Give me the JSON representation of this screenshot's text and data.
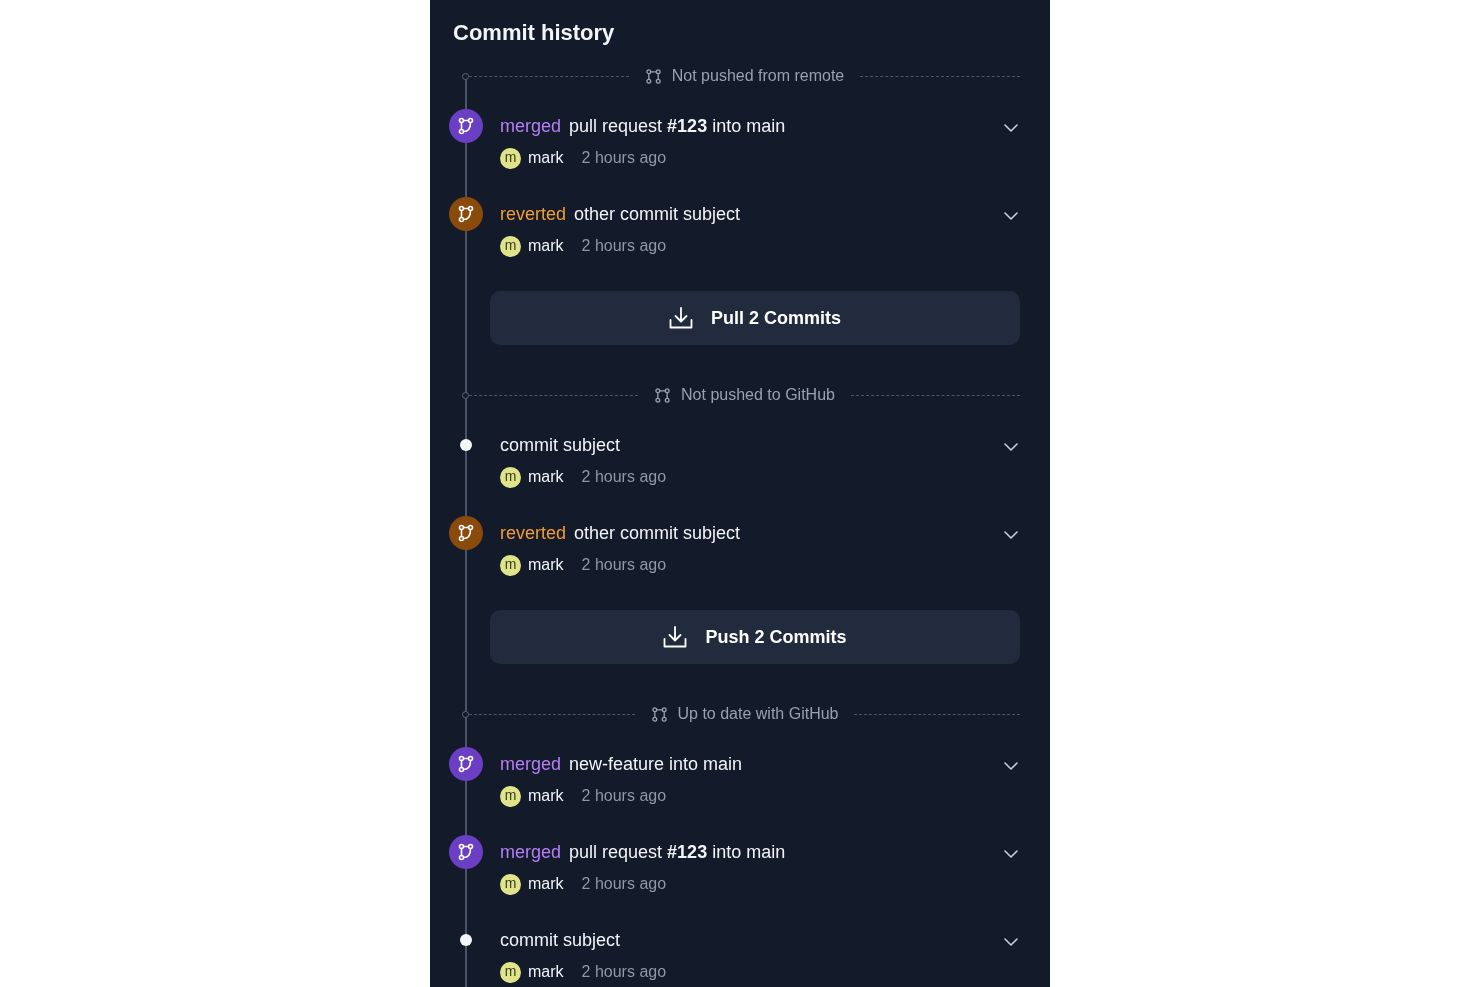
{
  "title": "Commit history",
  "sections": [
    {
      "status": "Not pushed from remote",
      "commits": [
        {
          "kind": "merge",
          "verb": "merged",
          "subject": "pull request **#123** into main",
          "avatar": "m",
          "author": "mark",
          "time": "2 hours ago"
        },
        {
          "kind": "revert",
          "verb": "reverted",
          "subject": "other commit subject",
          "avatar": "m",
          "author": "mark",
          "time": "2 hours ago"
        }
      ],
      "action": {
        "label": "Pull 2 Commits"
      }
    },
    {
      "status": "Not pushed to GitHub",
      "commits": [
        {
          "kind": "plain",
          "subject": "commit subject",
          "avatar": "m",
          "author": "mark",
          "time": "2 hours ago"
        },
        {
          "kind": "revert",
          "verb": "reverted",
          "subject": "other commit subject",
          "avatar": "m",
          "author": "mark",
          "time": "2 hours ago"
        }
      ],
      "action": {
        "label": "Push 2 Commits"
      }
    },
    {
      "status": "Up to date with GitHub",
      "commits": [
        {
          "kind": "merge",
          "verb": "merged",
          "subject": "new-feature into main",
          "avatar": "m",
          "author": "mark",
          "time": "2 hours ago"
        },
        {
          "kind": "merge",
          "verb": "merged",
          "subject": "pull request **#123** into main",
          "avatar": "m",
          "author": "mark",
          "time": "2 hours ago"
        },
        {
          "kind": "plain",
          "subject": "commit subject",
          "avatar": "m",
          "author": "mark",
          "time": "2 hours ago"
        }
      ]
    }
  ]
}
